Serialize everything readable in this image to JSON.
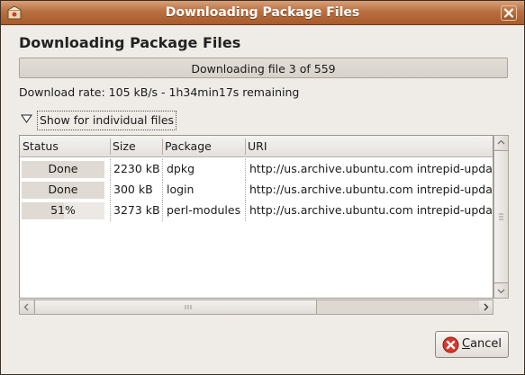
{
  "window": {
    "title": "Downloading Package Files",
    "icon": "package-icon",
    "close_icon": "close-icon"
  },
  "heading": "Downloading Package Files",
  "overall_progress": {
    "label": "Downloading file 3 of 559",
    "fraction": 0.0
  },
  "download_rate": "Download rate: 105 kB/s - 1h34min17s remaining",
  "expander": {
    "label": "Show for individual files",
    "expanded": true
  },
  "table": {
    "columns": [
      "Status",
      "Size",
      "Package",
      "URI"
    ],
    "rows": [
      {
        "status": "Done",
        "progress": 1.0,
        "size": "2230 kB",
        "package": "dpkg",
        "uri": "http://us.archive.ubuntu.com intrepid-updates/main dpkg"
      },
      {
        "status": "Done",
        "progress": 1.0,
        "size": "300 kB",
        "package": "login",
        "uri": "http://us.archive.ubuntu.com intrepid-updates/main login"
      },
      {
        "status": "51%",
        "progress": 0.51,
        "size": "3273 kB",
        "package": "perl-modules",
        "uri": "http://us.archive.ubuntu.com intrepid-updates/main perl-modules"
      }
    ]
  },
  "buttons": {
    "cancel_mnemonic": "C",
    "cancel_rest": "ancel",
    "cancel_icon": "cancel-icon"
  },
  "colors": {
    "titlebar": "#b96f3f",
    "window_bg": "#efebe7"
  }
}
